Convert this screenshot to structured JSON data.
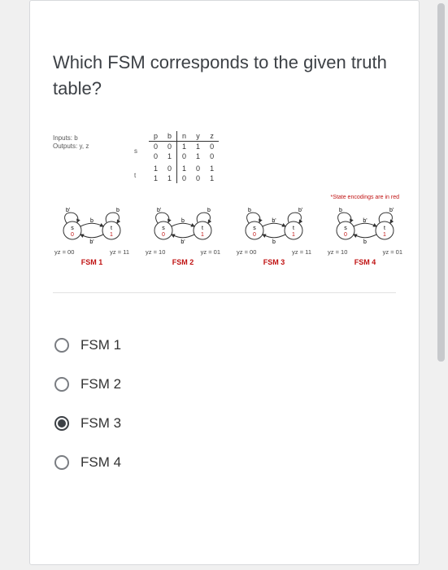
{
  "question": "Which FSM corresponds to the given truth table?",
  "io": {
    "inputs": "Inputs: b",
    "outputs": "Outputs: y, z"
  },
  "row_labels": {
    "s": "s",
    "t": "t"
  },
  "truth_table": {
    "headers": [
      "p",
      "b",
      "n",
      "y",
      "z"
    ],
    "rows": [
      [
        "0",
        "0",
        "1",
        "1",
        "0"
      ],
      [
        "0",
        "1",
        "0",
        "1",
        "0"
      ],
      [
        "1",
        "0",
        "1",
        "0",
        "1"
      ],
      [
        "1",
        "1",
        "0",
        "0",
        "1"
      ]
    ]
  },
  "state_note": "*State encodings are in red",
  "fsm": [
    {
      "name": "FSM 1",
      "left_enc": "yz = 00",
      "right_enc": "yz = 11",
      "s_label": "s",
      "t_label": "t",
      "s_code": "0",
      "t_code": "1",
      "top_left": "b'",
      "top_right": "b",
      "forward": "b",
      "back": "b'"
    },
    {
      "name": "FSM 2",
      "left_enc": "yz = 10",
      "right_enc": "yz = 01",
      "s_label": "s",
      "t_label": "t",
      "s_code": "0",
      "t_code": "1",
      "top_left": "b'",
      "top_right": "b",
      "forward": "b",
      "back": "b'"
    },
    {
      "name": "FSM 3",
      "left_enc": "yz = 00",
      "right_enc": "yz = 11",
      "s_label": "s",
      "t_label": "t",
      "s_code": "0",
      "t_code": "1",
      "top_left": "b",
      "top_right": "b'",
      "forward": "b'",
      "back": "b"
    },
    {
      "name": "FSM 4",
      "left_enc": "yz = 10",
      "right_enc": "yz = 01",
      "s_label": "s",
      "t_label": "t",
      "s_code": "0",
      "t_code": "1",
      "top_left": "b",
      "top_right": "b'",
      "forward": "b'",
      "back": "b"
    }
  ],
  "options": [
    "FSM 1",
    "FSM 2",
    "FSM 3",
    "FSM 4"
  ],
  "selected_index": 2
}
